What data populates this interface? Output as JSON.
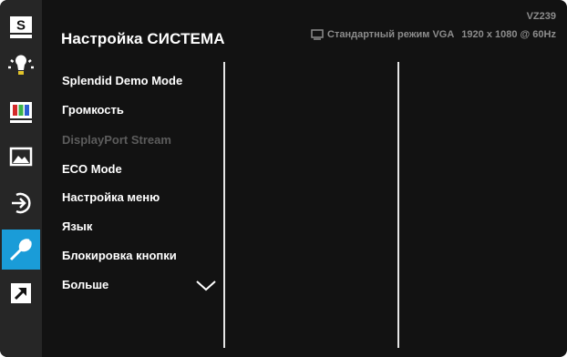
{
  "sidebar": {
    "items": [
      {
        "icon": "splendid-s-icon"
      },
      {
        "icon": "brightness-icon"
      },
      {
        "icon": "color-bars-icon"
      },
      {
        "icon": "image-icon"
      },
      {
        "icon": "input-select-icon"
      },
      {
        "icon": "wrench-icon",
        "active": true
      },
      {
        "icon": "shortcut-arrow-icon"
      }
    ],
    "badge_letter": "S",
    "active_color": "#1a9cd8"
  },
  "header": {
    "title": "Настройка СИСТЕМА",
    "model": "VZ239",
    "mode": "Стандартный режим VGA",
    "resolution": "1920 x 1080 @ 60Hz"
  },
  "menu": {
    "items": [
      {
        "label": "Splendid Demo Mode",
        "enabled": true
      },
      {
        "label": "Громкость",
        "enabled": true
      },
      {
        "label": "DisplayPort Stream",
        "enabled": false
      },
      {
        "label": "ECO Mode",
        "enabled": true
      },
      {
        "label": "Настройка меню",
        "enabled": true
      },
      {
        "label": "Язык",
        "enabled": true
      },
      {
        "label": "Блокировка кнопки",
        "enabled": true
      },
      {
        "label": "Больше",
        "enabled": true
      }
    ]
  }
}
